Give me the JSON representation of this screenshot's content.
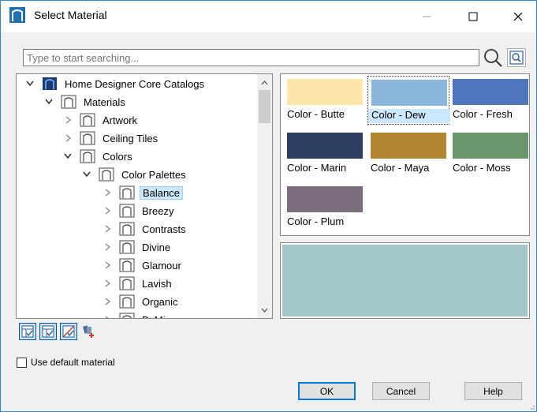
{
  "window": {
    "title": "Select Material",
    "controls": {
      "minimize": "—",
      "maximize": "☐",
      "close": "✕"
    }
  },
  "search": {
    "placeholder": "Type to start searching..."
  },
  "tree": {
    "items": [
      {
        "label": "Home Designer Core Catalogs",
        "level": 0,
        "expanded": true,
        "icon": "catalog-icon"
      },
      {
        "label": "Materials",
        "level": 1,
        "expanded": true,
        "icon": "folder-icon"
      },
      {
        "label": "Artwork",
        "level": 2,
        "expanded": false,
        "icon": "folder-icon"
      },
      {
        "label": "Ceiling Tiles",
        "level": 2,
        "expanded": false,
        "icon": "folder-icon"
      },
      {
        "label": "Colors",
        "level": 2,
        "expanded": true,
        "icon": "folder-icon"
      },
      {
        "label": "Color Palettes",
        "level": 3,
        "expanded": true,
        "icon": "folder-icon"
      },
      {
        "label": "Balance",
        "level": 4,
        "expanded": false,
        "selected": true,
        "icon": "folder-icon"
      },
      {
        "label": "Breezy",
        "level": 4,
        "expanded": false,
        "icon": "folder-icon"
      },
      {
        "label": "Contrasts",
        "level": 4,
        "expanded": false,
        "icon": "folder-icon"
      },
      {
        "label": "Divine",
        "level": 4,
        "expanded": false,
        "icon": "folder-icon"
      },
      {
        "label": "Glamour",
        "level": 4,
        "expanded": false,
        "icon": "folder-icon"
      },
      {
        "label": "Lavish",
        "level": 4,
        "expanded": false,
        "icon": "folder-icon"
      },
      {
        "label": "Organic",
        "level": 4,
        "expanded": false,
        "icon": "folder-icon"
      },
      {
        "label": "PoMi...",
        "level": 4,
        "expanded": false,
        "icon": "folder-icon"
      }
    ]
  },
  "swatches": [
    {
      "label": "Color - Butte",
      "color": "#fde5ab"
    },
    {
      "label": "Color - Dew",
      "color": "#8bb7dc",
      "selected": true
    },
    {
      "label": "Color - Fresh",
      "color": "#4f76bd"
    },
    {
      "label": "Color - Marin",
      "color": "#2d3d63"
    },
    {
      "label": "Color - Maya",
      "color": "#b38634"
    },
    {
      "label": "Color - Moss",
      "color": "#6b9669"
    },
    {
      "label": "Color - Plum",
      "color": "#7b6d7e"
    }
  ],
  "preview": {
    "color": "#a3c6c8"
  },
  "toolbar": {
    "buttons": [
      "material-view-icon",
      "material-list-icon",
      "no-material-icon",
      "add-to-library-icon"
    ]
  },
  "options": {
    "use_default_label": "Use default material",
    "use_default_checked": false
  },
  "buttons": {
    "ok": "OK",
    "cancel": "Cancel",
    "help": "Help"
  },
  "colors": {
    "accent": "#0078d7",
    "selection": "#cce8ff",
    "catalog_icon": "#1f3a6e"
  }
}
